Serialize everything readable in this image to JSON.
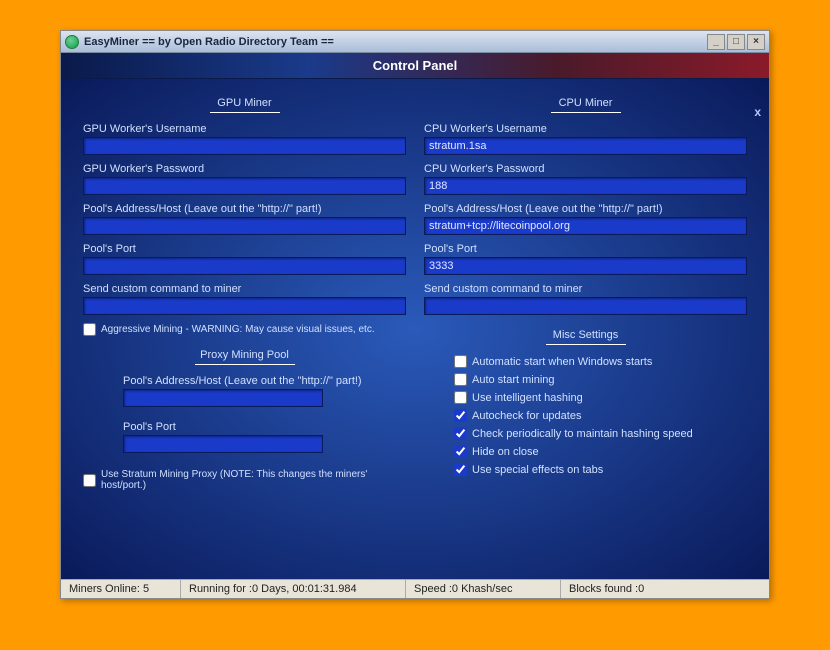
{
  "window": {
    "title": "EasyMiner == by Open Radio Directory Team =="
  },
  "header": {
    "title": "Control Panel",
    "close_x": "x"
  },
  "gpu": {
    "section": "GPU Miner",
    "username_label": "GPU Worker's Username",
    "username_value": "",
    "password_label": "GPU Worker's Password",
    "password_value": "",
    "host_label": "Pool's Address/Host (Leave out the \"http://\" part!)",
    "host_value": "",
    "port_label": "Pool's Port",
    "port_value": "",
    "custom_label": "Send custom command to miner",
    "custom_value": "",
    "aggressive_label": "Aggressive Mining - WARNING: May cause visual issues, etc.",
    "aggressive_checked": false
  },
  "proxy": {
    "section": "Proxy Mining Pool",
    "host_label": "Pool's Address/Host (Leave out the \"http://\" part!)",
    "host_value": "",
    "port_label": "Pool's Port",
    "port_value": "",
    "stratum_label": "Use Stratum Mining Proxy (NOTE: This changes the miners' host/port.)",
    "stratum_checked": false
  },
  "cpu": {
    "section": "CPU Miner",
    "username_label": "CPU Worker's Username",
    "username_value": "stratum.1sa",
    "password_label": "CPU Worker's Password",
    "password_value": "188",
    "host_label": "Pool's Address/Host (Leave out the \"http://\" part!)",
    "host_value": "stratum+tcp://litecoinpool.org",
    "port_label": "Pool's Port",
    "port_value": "3333",
    "custom_label": "Send custom command to miner",
    "custom_value": ""
  },
  "misc": {
    "section": "Misc Settings",
    "items": [
      {
        "label": "Automatic start when Windows starts",
        "checked": false
      },
      {
        "label": "Auto start mining",
        "checked": false
      },
      {
        "label": "Use intelligent hashing",
        "checked": false
      },
      {
        "label": "Autocheck for updates",
        "checked": true
      },
      {
        "label": "Check periodically to maintain hashing speed",
        "checked": true
      },
      {
        "label": "Hide on close",
        "checked": true
      },
      {
        "label": "Use special effects on tabs",
        "checked": true
      }
    ]
  },
  "status": {
    "miners": "Miners Online: 5",
    "running": "Running for :0 Days, 00:01:31.984",
    "speed": "Speed :0 Khash/sec",
    "blocks": "Blocks found :0"
  }
}
